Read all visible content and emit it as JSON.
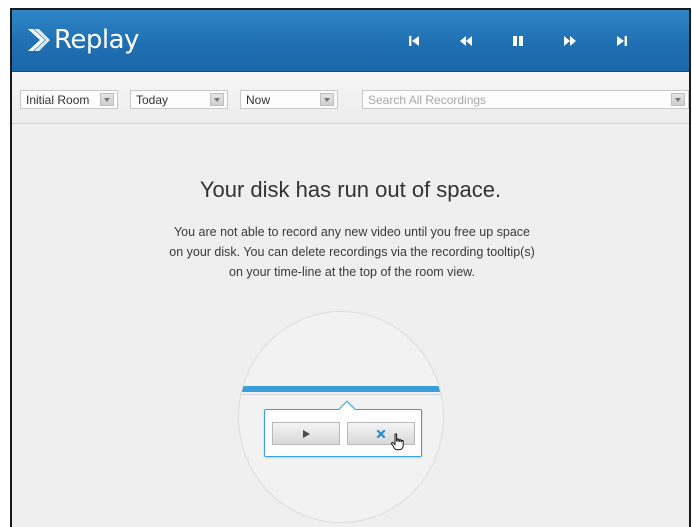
{
  "app": {
    "name": "Replay",
    "accent_color": "#1f70b3",
    "highlight_color": "#3a9fd8"
  },
  "header": {
    "controls": [
      {
        "icon": "skip-back-icon"
      },
      {
        "icon": "rewind-icon"
      },
      {
        "icon": "pause-icon"
      },
      {
        "icon": "fast-forward-icon"
      },
      {
        "icon": "skip-forward-icon"
      }
    ]
  },
  "toolbar": {
    "room_select": "Initial Room",
    "date_select": "Today",
    "time_select": "Now",
    "search_placeholder": "Search All Recordings"
  },
  "main": {
    "headline": "Your disk has run out of space.",
    "message_lines": [
      "You are not able to record any new video until you free up space",
      "on your disk. You can delete recordings via the recording tooltip(s)",
      "on your time-line at the top of the room view."
    ]
  },
  "illustration": {
    "play_icon": "play-icon",
    "delete_icon": "close-icon",
    "cursor_icon": "hand-pointer-icon"
  }
}
